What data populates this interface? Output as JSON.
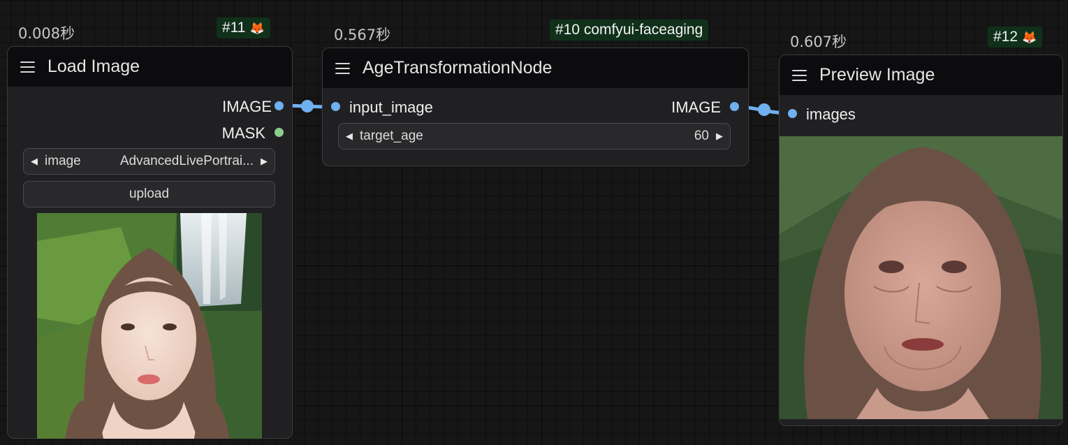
{
  "colors": {
    "canvas_bg": "#161616",
    "node_bg": "#202023",
    "node_header_bg": "#0c0c0e",
    "image_link": "#6fb0ee",
    "mask_slot": "#8ccf8d",
    "badge_bg": "#10301a"
  },
  "nodes": {
    "load_image": {
      "timing": "0.008秒",
      "badge": "#11",
      "badge_icon": "fox-icon",
      "title": "Load Image",
      "outputs": {
        "image": "IMAGE",
        "mask": "MASK"
      },
      "image_widget": {
        "label": "image",
        "value": "AdvancedLivePortrai..."
      },
      "upload_label": "upload"
    },
    "age_transformation": {
      "timing": "0.567秒",
      "badge": "#10 comfyui-faceaging",
      "title": "AgeTransformationNode",
      "input": "input_image",
      "output": "IMAGE",
      "target_age_widget": {
        "label": "target_age",
        "value": "60"
      }
    },
    "preview_image": {
      "timing": "0.607秒",
      "badge": "#12",
      "badge_icon": "fox-icon",
      "title": "Preview Image",
      "input": "images"
    }
  }
}
